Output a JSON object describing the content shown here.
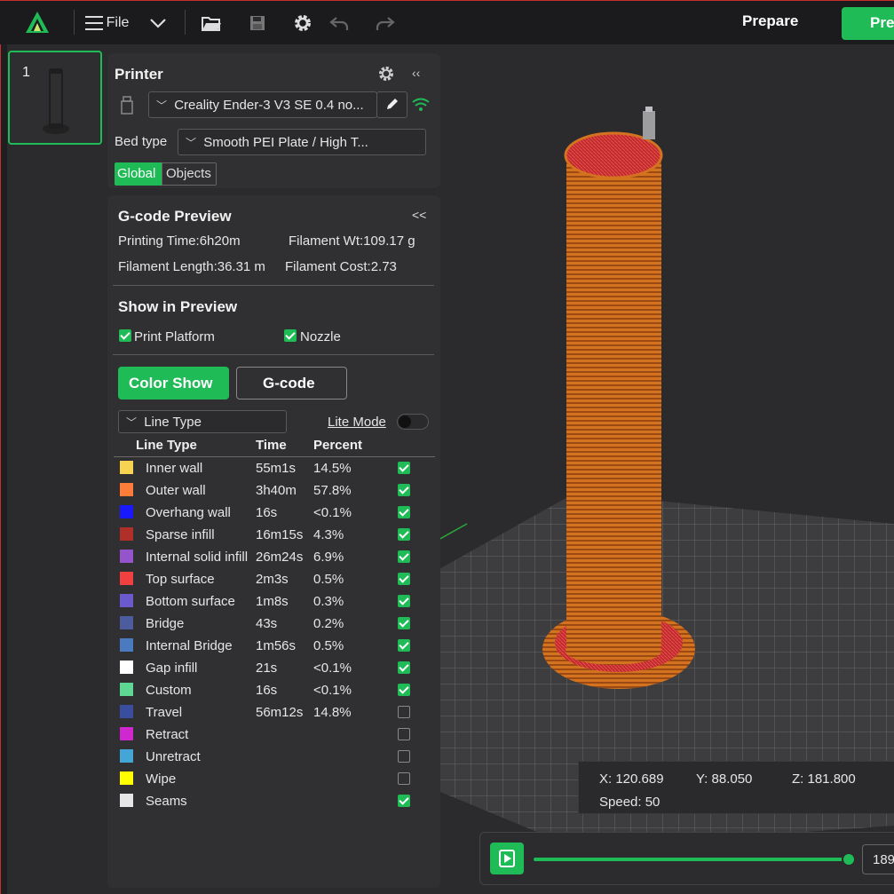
{
  "topbar": {
    "file_label": "File",
    "prepare_label": "Prepare",
    "preview_label": "Preview"
  },
  "plates": [
    {
      "number": "1"
    }
  ],
  "printer": {
    "title": "Printer",
    "printer_name": "Creality Ender-3 V3 SE 0.4 no...",
    "bed_type_label": "Bed type",
    "bed_type_value": "Smooth PEI Plate / High T...",
    "tab_global": "Global",
    "tab_objects": "Objects"
  },
  "gcode": {
    "title": "G-code Preview",
    "collapse": "<<",
    "printing_time": "Printing Time:6h20m",
    "filament_wt": "Filament Wt:109.17 g",
    "filament_length": "Filament Length:36.31 m",
    "filament_cost": "Filament Cost:2.73",
    "show_title": "Show in Preview",
    "print_platform": "Print Platform",
    "nozzle": "Nozzle",
    "color_show": "Color Show",
    "gcode_btn": "G-code",
    "view_select": "Line Type",
    "lite_mode": "Lite Mode",
    "headers": {
      "type": "Line Type",
      "time": "Time",
      "percent": "Percent"
    },
    "rows": [
      {
        "name": "Inner wall",
        "time": "55m1s",
        "percent": "14.5%",
        "color": "#f6d350",
        "checked": true
      },
      {
        "name": "Outer wall",
        "time": "3h40m",
        "percent": "57.8%",
        "color": "#ff7d38",
        "checked": true
      },
      {
        "name": "Overhang wall",
        "time": "16s",
        "percent": "<0.1%",
        "color": "#1919ff",
        "checked": true
      },
      {
        "name": "Sparse infill",
        "time": "16m15s",
        "percent": "4.3%",
        "color": "#b03029",
        "checked": true
      },
      {
        "name": "Internal solid infill",
        "time": "26m24s",
        "percent": "6.9%",
        "color": "#9654cc",
        "checked": true
      },
      {
        "name": "Top surface",
        "time": "2m3s",
        "percent": "0.5%",
        "color": "#f04040",
        "checked": true
      },
      {
        "name": "Bottom surface",
        "time": "1m8s",
        "percent": "0.3%",
        "color": "#6a5acd",
        "checked": true
      },
      {
        "name": "Bridge",
        "time": "43s",
        "percent": "0.2%",
        "color": "#4d5c9e",
        "checked": true
      },
      {
        "name": "Internal Bridge",
        "time": "1m56s",
        "percent": "0.5%",
        "color": "#4a7bc0",
        "checked": true
      },
      {
        "name": "Gap infill",
        "time": "21s",
        "percent": "<0.1%",
        "color": "#ffffff",
        "checked": true
      },
      {
        "name": "Custom",
        "time": "16s",
        "percent": "<0.1%",
        "color": "#5ed694",
        "checked": true
      },
      {
        "name": "Travel",
        "time": "56m12s",
        "percent": "14.8%",
        "color": "#3a4ea0",
        "checked": false
      },
      {
        "name": "Retract",
        "time": "",
        "percent": "",
        "color": "#cf28cf",
        "checked": false
      },
      {
        "name": "Unretract",
        "time": "",
        "percent": "",
        "color": "#43a6d6",
        "checked": false
      },
      {
        "name": "Wipe",
        "time": "",
        "percent": "",
        "color": "#ffff00",
        "checked": false
      },
      {
        "name": "Seams",
        "time": "",
        "percent": "",
        "color": "#e6e6e6",
        "checked": true
      }
    ]
  },
  "status": {
    "x": "X: 120.689",
    "y": "Y: 88.050",
    "z": "Z: 181.800",
    "speed": "Speed: 50"
  },
  "slider": {
    "layer_value": "189",
    "progress": 1.0
  },
  "colors": {
    "accent": "#1fbb56",
    "model": "#e07a2a"
  }
}
